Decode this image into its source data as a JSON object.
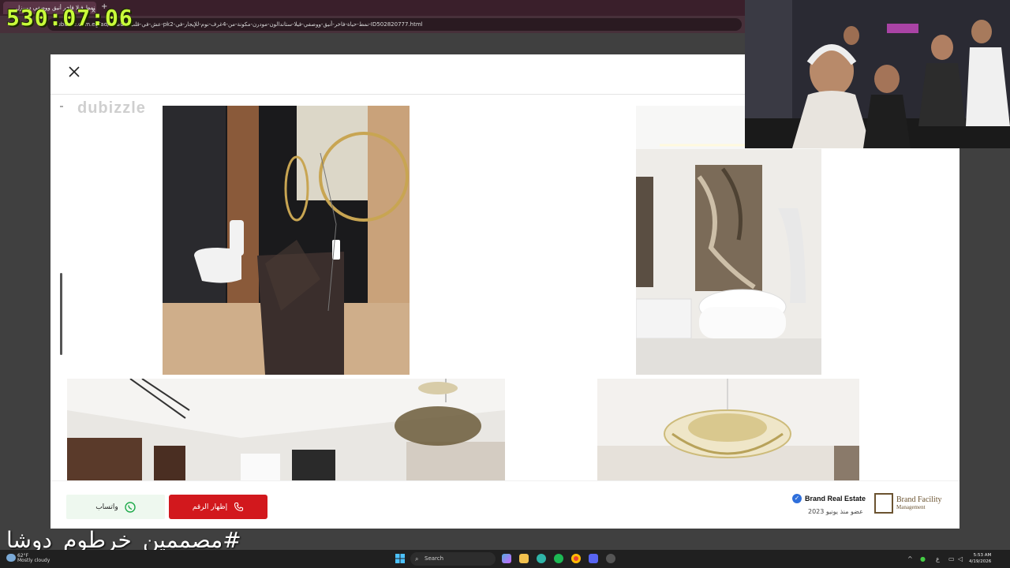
{
  "browser": {
    "tab_title": "نمط فيلا فاخر أنيق ووصفي دوبيزل",
    "tab_close": "×",
    "new_tab": "+",
    "url": "dubizzle.com.eg/ad/عش-في-قلب-العاصمة-pk2-نمط-حياة-فاخر-أنيق-ووصفي-فيلا-ستاندالون-مودرن-مكونة-من-4غرف-نوم-للإيجار-في-ID502820777.html"
  },
  "overlay": {
    "counter": "530:07:06",
    "hashtag": "#مصممين_خرطوم_دوشا"
  },
  "modal": {
    "watermark": "dubizzle",
    "close_icon": "close-icon"
  },
  "actions": {
    "whatsapp_label": "واتساب",
    "show_number_label": "إظهار الرقم"
  },
  "seller": {
    "name": "Brand Real Estate",
    "member_since": "عضو منذ يونيو 2023",
    "logo_line1": "Brand Facility",
    "logo_line2": "Management"
  },
  "taskbar": {
    "weather_temp": "62°F",
    "weather_desc": "Mostly cloudy",
    "search_label": "Search",
    "time": "5:53 AM",
    "date": "4/19/2026"
  },
  "colors": {
    "call_button": "#d2181d",
    "whatsapp_bg": "#eef8ef",
    "counter": "#c9ff3a",
    "brand": "#6b5330"
  }
}
